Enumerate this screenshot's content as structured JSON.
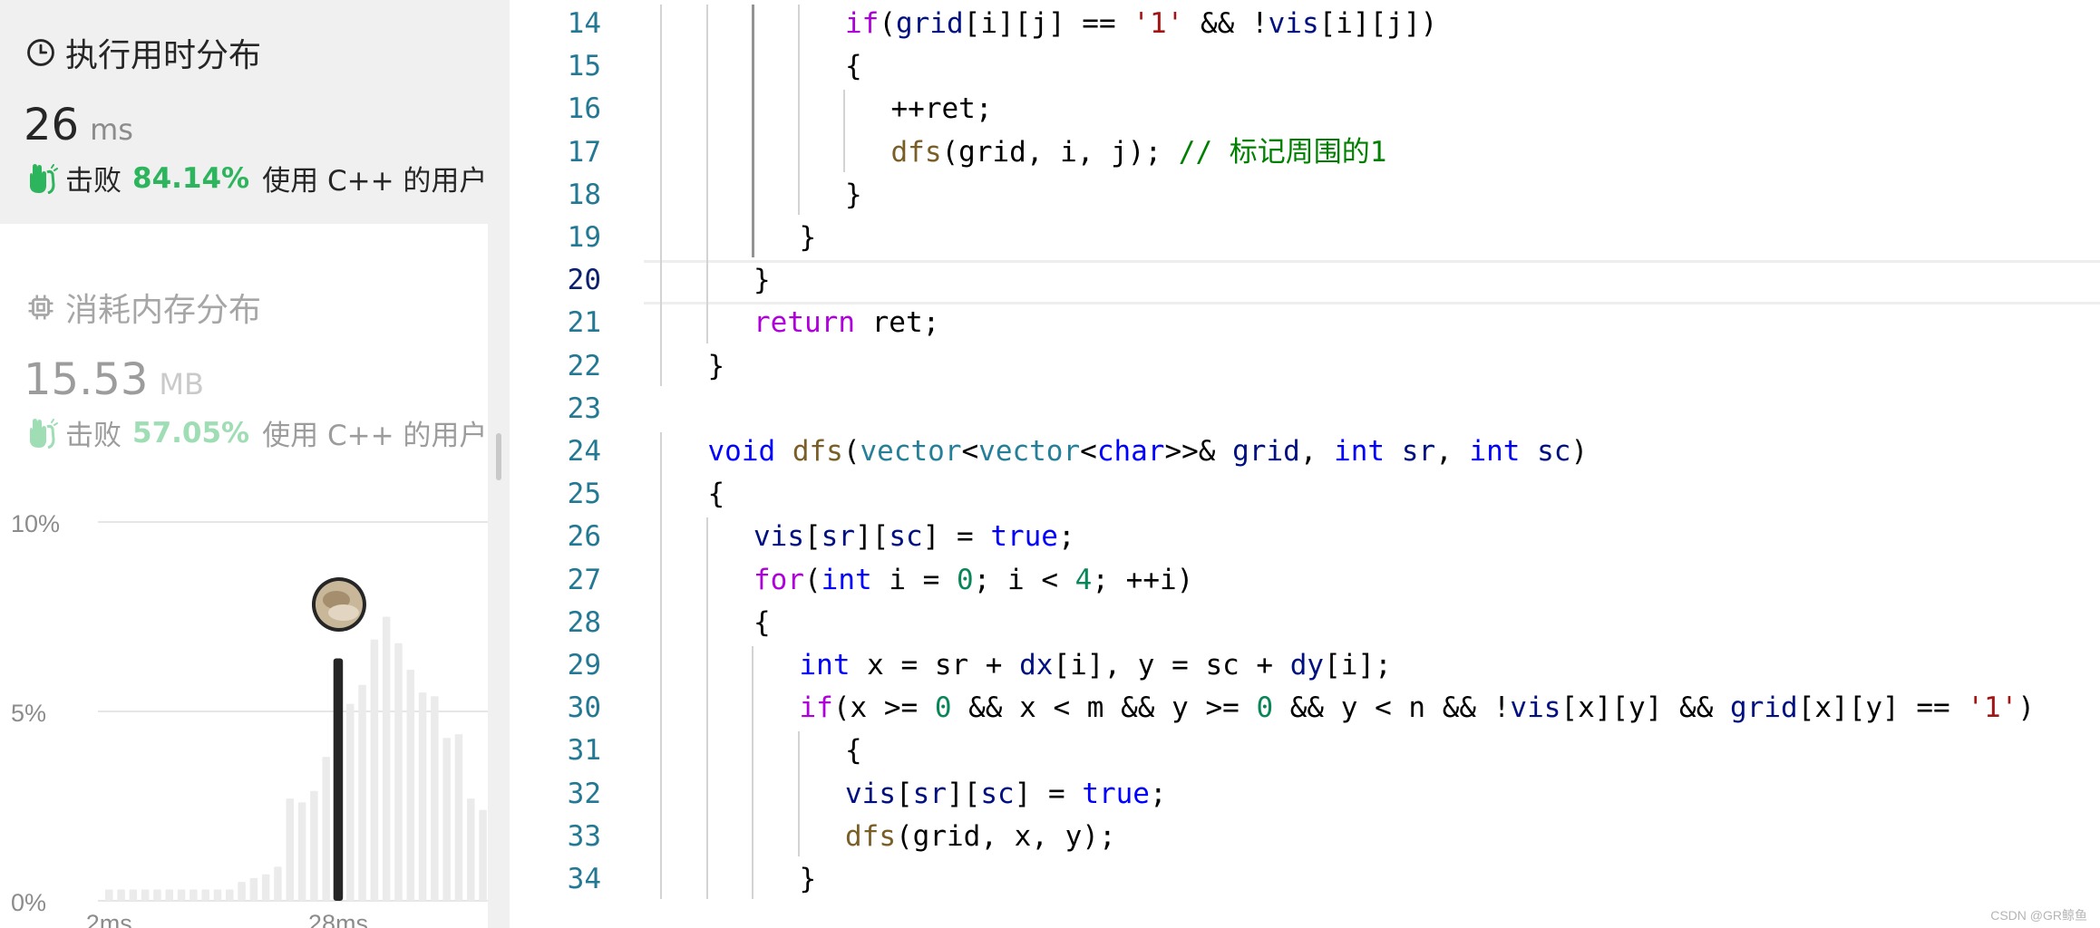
{
  "runtime": {
    "title": "执行用时分布",
    "value": "26",
    "unit": "ms",
    "beat_prefix": "击败",
    "beat_percent": "84.14%",
    "beat_suffix": "使用 C++ 的用户"
  },
  "memory": {
    "title": "消耗内存分布",
    "value": "15.53",
    "unit": "MB",
    "beat_prefix": "击败",
    "beat_percent": "57.05%",
    "beat_suffix": "使用 C++ 的用户"
  },
  "chart_data": {
    "type": "bar",
    "y_ticks": [
      "10%",
      "5%",
      "0%"
    ],
    "ylim": [
      0,
      10
    ],
    "x_ticks": [
      "2ms",
      "28ms"
    ],
    "values": [
      0.3,
      0.3,
      0.3,
      0.3,
      0.3,
      0.3,
      0.3,
      0.3,
      0.3,
      0.3,
      0.3,
      0.5,
      0.6,
      0.7,
      0.9,
      2.7,
      2.6,
      2.9,
      3.8,
      6.4,
      5.2,
      5.7,
      6.9,
      7.5,
      6.8,
      6.1,
      5.5,
      5.4,
      4.3,
      4.4,
      2.7,
      2.4
    ],
    "highlight_index": 19,
    "colors": {
      "bar": "#ebebeb",
      "highlight": "#262626",
      "grid": "#e6e6e6"
    }
  },
  "editor": {
    "current_line": 20,
    "lines": [
      {
        "n": "14",
        "tokens": [
          {
            "c": "k",
            "t": "if"
          },
          {
            "c": "p",
            "t": "("
          },
          {
            "c": "v",
            "t": "grid"
          },
          {
            "c": "p",
            "t": "[i][j] == "
          },
          {
            "c": "s",
            "t": "'1'"
          },
          {
            "c": "p",
            "t": " && !"
          },
          {
            "c": "v",
            "t": "vis"
          },
          {
            "c": "p",
            "t": "[i][j])"
          }
        ]
      },
      {
        "n": "15",
        "tokens": [
          {
            "c": "p",
            "t": "{"
          }
        ]
      },
      {
        "n": "16",
        "tokens": [
          {
            "c": "p",
            "t": "++ret;"
          }
        ]
      },
      {
        "n": "17",
        "tokens": [
          {
            "c": "f",
            "t": "dfs"
          },
          {
            "c": "p",
            "t": "(grid, i, j); "
          },
          {
            "c": "c",
            "t": "// 标记周围的1"
          }
        ]
      },
      {
        "n": "18",
        "tokens": [
          {
            "c": "p",
            "t": "}"
          }
        ]
      },
      {
        "n": "19",
        "tokens": [
          {
            "c": "p",
            "t": "}"
          }
        ]
      },
      {
        "n": "20",
        "tokens": [
          {
            "c": "p",
            "t": "}"
          }
        ]
      },
      {
        "n": "21",
        "tokens": [
          {
            "c": "k",
            "t": "return"
          },
          {
            "c": "p",
            "t": " ret;"
          }
        ]
      },
      {
        "n": "22",
        "tokens": [
          {
            "c": "p",
            "t": "}"
          }
        ]
      },
      {
        "n": "23",
        "tokens": []
      },
      {
        "n": "24",
        "tokens": [
          {
            "c": "t",
            "t": "void"
          },
          {
            "c": "p",
            "t": " "
          },
          {
            "c": "f",
            "t": "dfs"
          },
          {
            "c": "p",
            "t": "("
          },
          {
            "c": "ty",
            "t": "vector"
          },
          {
            "c": "p",
            "t": "<"
          },
          {
            "c": "ty",
            "t": "vector"
          },
          {
            "c": "p",
            "t": "<"
          },
          {
            "c": "t",
            "t": "char"
          },
          {
            "c": "p",
            "t": ">>& "
          },
          {
            "c": "v",
            "t": "grid"
          },
          {
            "c": "p",
            "t": ", "
          },
          {
            "c": "t",
            "t": "int"
          },
          {
            "c": "p",
            "t": " "
          },
          {
            "c": "v",
            "t": "sr"
          },
          {
            "c": "p",
            "t": ", "
          },
          {
            "c": "t",
            "t": "int"
          },
          {
            "c": "p",
            "t": " "
          },
          {
            "c": "v",
            "t": "sc"
          },
          {
            "c": "p",
            "t": ")"
          }
        ]
      },
      {
        "n": "25",
        "tokens": [
          {
            "c": "p",
            "t": "{"
          }
        ]
      },
      {
        "n": "26",
        "tokens": [
          {
            "c": "v",
            "t": "vis"
          },
          {
            "c": "p",
            "t": "["
          },
          {
            "c": "v",
            "t": "sr"
          },
          {
            "c": "p",
            "t": "]["
          },
          {
            "c": "v",
            "t": "sc"
          },
          {
            "c": "p",
            "t": "] = "
          },
          {
            "c": "t",
            "t": "true"
          },
          {
            "c": "p",
            "t": ";"
          }
        ]
      },
      {
        "n": "27",
        "tokens": [
          {
            "c": "k",
            "t": "for"
          },
          {
            "c": "p",
            "t": "("
          },
          {
            "c": "t",
            "t": "int"
          },
          {
            "c": "p",
            "t": " i = "
          },
          {
            "c": "n",
            "t": "0"
          },
          {
            "c": "p",
            "t": "; i < "
          },
          {
            "c": "n",
            "t": "4"
          },
          {
            "c": "p",
            "t": "; ++i)"
          }
        ]
      },
      {
        "n": "28",
        "tokens": [
          {
            "c": "p",
            "t": "{"
          }
        ]
      },
      {
        "n": "29",
        "tokens": [
          {
            "c": "t",
            "t": "int"
          },
          {
            "c": "p",
            "t": " x = sr + "
          },
          {
            "c": "v",
            "t": "dx"
          },
          {
            "c": "p",
            "t": "[i], y = sc + "
          },
          {
            "c": "v",
            "t": "dy"
          },
          {
            "c": "p",
            "t": "[i];"
          }
        ]
      },
      {
        "n": "30",
        "tokens": [
          {
            "c": "k",
            "t": "if"
          },
          {
            "c": "p",
            "t": "(x >= "
          },
          {
            "c": "n",
            "t": "0"
          },
          {
            "c": "p",
            "t": " && x < m && y >= "
          },
          {
            "c": "n",
            "t": "0"
          },
          {
            "c": "p",
            "t": " && y < n && !"
          },
          {
            "c": "v",
            "t": "vis"
          },
          {
            "c": "p",
            "t": "[x][y] && "
          },
          {
            "c": "v",
            "t": "grid"
          },
          {
            "c": "p",
            "t": "[x][y] == "
          },
          {
            "c": "s",
            "t": "'1'"
          },
          {
            "c": "p",
            "t": ")"
          }
        ]
      },
      {
        "n": "31",
        "tokens": [
          {
            "c": "p",
            "t": "{"
          }
        ]
      },
      {
        "n": "32",
        "tokens": [
          {
            "c": "v",
            "t": "vis"
          },
          {
            "c": "p",
            "t": "["
          },
          {
            "c": "v",
            "t": "sr"
          },
          {
            "c": "p",
            "t": "]["
          },
          {
            "c": "v",
            "t": "sc"
          },
          {
            "c": "p",
            "t": "] = "
          },
          {
            "c": "t",
            "t": "true"
          },
          {
            "c": "p",
            "t": ";"
          }
        ]
      },
      {
        "n": "33",
        "tokens": [
          {
            "c": "f",
            "t": "dfs"
          },
          {
            "c": "p",
            "t": "(grid, x, y);"
          }
        ]
      },
      {
        "n": "34",
        "tokens": [
          {
            "c": "p",
            "t": "}"
          }
        ]
      }
    ]
  },
  "watermark": "CSDN @GR鲸鱼"
}
